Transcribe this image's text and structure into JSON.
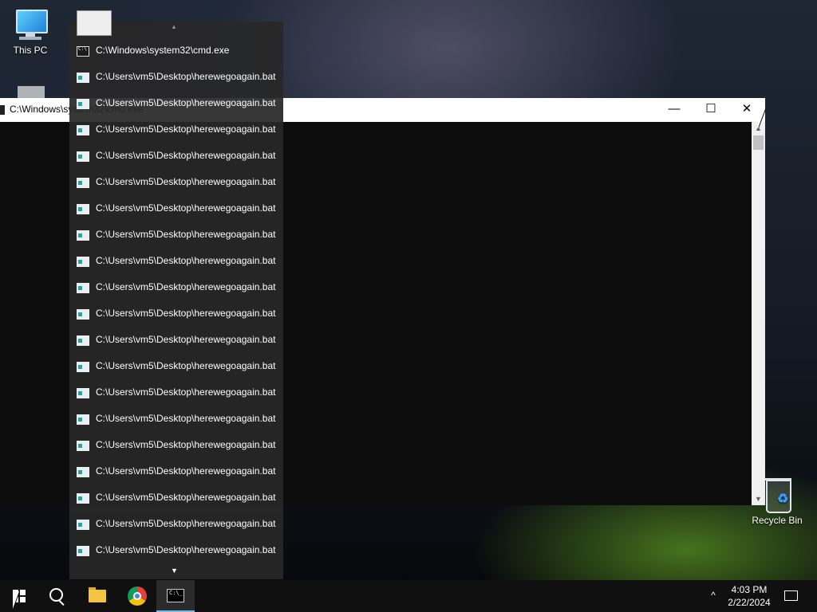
{
  "desktop": {
    "icons": [
      {
        "label": "This PC",
        "icon": "computer-icon"
      },
      {
        "label": "Recycle Bin",
        "icon": "recycle-bin-icon"
      }
    ]
  },
  "cmd_window": {
    "title": "C:\\Windows\\system32\\cmd.exe",
    "minimize_glyph": "—",
    "maximize_glyph": "☐",
    "close_glyph": "✕",
    "scroll_up_glyph": "▲",
    "scroll_down_glyph": "▼"
  },
  "jump_list": {
    "top_arrow": "▲",
    "bottom_arrow": "▼",
    "items": [
      {
        "label": "C:\\Windows\\system32\\cmd.exe",
        "icon": "cmd-icon"
      },
      {
        "label": "C:\\Users\\vm5\\Desktop\\herewegoagain.bat",
        "icon": "batch-file-icon"
      },
      {
        "label": "C:\\Users\\vm5\\Desktop\\herewegoagain.bat",
        "icon": "batch-file-icon"
      },
      {
        "label": "C:\\Users\\vm5\\Desktop\\herewegoagain.bat",
        "icon": "batch-file-icon"
      },
      {
        "label": "C:\\Users\\vm5\\Desktop\\herewegoagain.bat",
        "icon": "batch-file-icon"
      },
      {
        "label": "C:\\Users\\vm5\\Desktop\\herewegoagain.bat",
        "icon": "batch-file-icon"
      },
      {
        "label": "C:\\Users\\vm5\\Desktop\\herewegoagain.bat",
        "icon": "batch-file-icon"
      },
      {
        "label": "C:\\Users\\vm5\\Desktop\\herewegoagain.bat",
        "icon": "batch-file-icon"
      },
      {
        "label": "C:\\Users\\vm5\\Desktop\\herewegoagain.bat",
        "icon": "batch-file-icon"
      },
      {
        "label": "C:\\Users\\vm5\\Desktop\\herewegoagain.bat",
        "icon": "batch-file-icon"
      },
      {
        "label": "C:\\Users\\vm5\\Desktop\\herewegoagain.bat",
        "icon": "batch-file-icon"
      },
      {
        "label": "C:\\Users\\vm5\\Desktop\\herewegoagain.bat",
        "icon": "batch-file-icon"
      },
      {
        "label": "C:\\Users\\vm5\\Desktop\\herewegoagain.bat",
        "icon": "batch-file-icon"
      },
      {
        "label": "C:\\Users\\vm5\\Desktop\\herewegoagain.bat",
        "icon": "batch-file-icon"
      },
      {
        "label": "C:\\Users\\vm5\\Desktop\\herewegoagain.bat",
        "icon": "batch-file-icon"
      },
      {
        "label": "C:\\Users\\vm5\\Desktop\\herewegoagain.bat",
        "icon": "batch-file-icon"
      },
      {
        "label": "C:\\Users\\vm5\\Desktop\\herewegoagain.bat",
        "icon": "batch-file-icon"
      },
      {
        "label": "C:\\Users\\vm5\\Desktop\\herewegoagain.bat",
        "icon": "batch-file-icon"
      },
      {
        "label": "C:\\Users\\vm5\\Desktop\\herewegoagain.bat",
        "icon": "batch-file-icon"
      },
      {
        "label": "C:\\Users\\vm5\\Desktop\\herewegoagain.bat",
        "icon": "batch-file-icon"
      }
    ]
  },
  "taskbar": {
    "buttons": [
      {
        "name": "start-button",
        "icon": "windows-logo-icon"
      },
      {
        "name": "search-button",
        "icon": "search-icon"
      },
      {
        "name": "file-explorer-button",
        "icon": "folder-icon"
      },
      {
        "name": "chrome-button",
        "icon": "chrome-icon"
      },
      {
        "name": "command-prompt-button",
        "icon": "cmd-icon",
        "active": true
      }
    ],
    "tray_chevron": "^",
    "clock": {
      "time": "4:03 PM",
      "date": "2/22/2024"
    },
    "notification_icon": "notification-icon"
  },
  "colors": {
    "taskbar": "#101010",
    "console_bg": "#0c0c0c",
    "jump_list_bg": "#282828",
    "active_indicator": "#76b9ed"
  }
}
